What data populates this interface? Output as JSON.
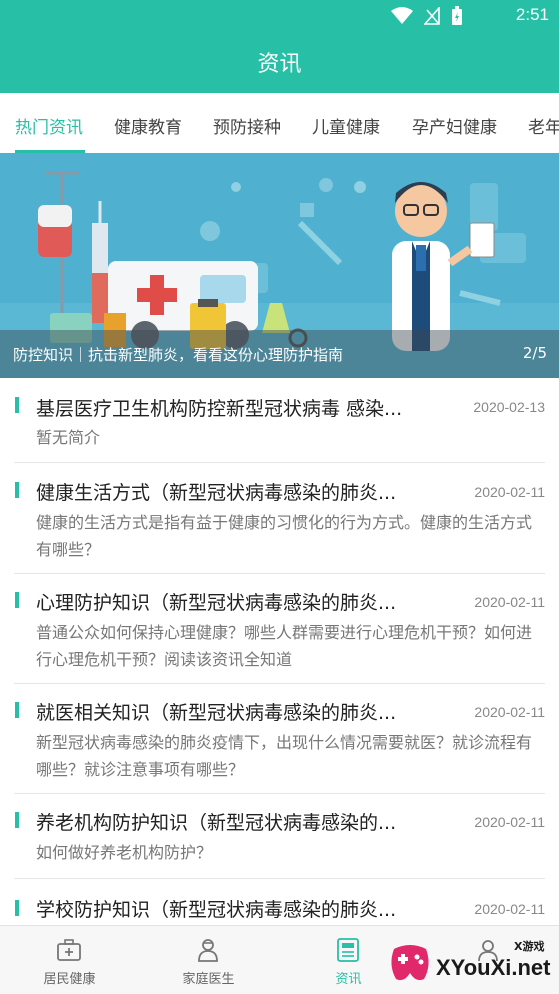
{
  "status": {
    "time": "2:51"
  },
  "appbar": {
    "title": "资讯"
  },
  "tabs": [
    {
      "label": "热门资讯",
      "active": true
    },
    {
      "label": "健康教育"
    },
    {
      "label": "预防接种"
    },
    {
      "label": "儿童健康"
    },
    {
      "label": "孕产妇健康"
    },
    {
      "label": "老年"
    }
  ],
  "banner": {
    "caption": "防控知识｜抗击新型肺炎，看看这份心理防护指南",
    "pager": "2/5"
  },
  "news": [
    {
      "title": "基层医疗卫生机构防控新型冠状病毒 感染...",
      "date": "2020-02-13",
      "desc": "暂无简介"
    },
    {
      "title": "健康生活方式（新型冠状病毒感染的肺炎...",
      "date": "2020-02-11",
      "desc": "健康的生活方式是指有益于健康的习惯化的行为方式。健康的生活方式有哪些？"
    },
    {
      "title": "心理防护知识（新型冠状病毒感染的肺炎...",
      "date": "2020-02-11",
      "desc": "普通公众如何保持心理健康？哪些人群需要进行心理危机干预？如何进行心理危机干预？阅读该资讯全知道"
    },
    {
      "title": "就医相关知识（新型冠状病毒感染的肺炎...",
      "date": "2020-02-11",
      "desc": "新型冠状病毒感染的肺炎疫情下，出现什么情况需要就医？就诊流程有哪些？就诊注意事项有哪些？"
    },
    {
      "title": "养老机构防护知识（新型冠状病毒感染的...",
      "date": "2020-02-11",
      "desc": "如何做好养老机构防护？"
    },
    {
      "title": "学校防护知识（新型冠状病毒感染的肺炎...",
      "date": "2020-02-11",
      "desc": ""
    }
  ],
  "bottomnav": [
    {
      "label": "居民健康",
      "icon": "medical-kit-icon"
    },
    {
      "label": "家庭医生",
      "icon": "doctor-icon"
    },
    {
      "label": "资讯",
      "icon": "news-icon",
      "active": true
    },
    {
      "label": "",
      "icon": "profile-icon"
    }
  ],
  "watermark": {
    "text": "XYouXi.net",
    "small": "X游戏"
  },
  "colors": {
    "primary": "#27c0a6",
    "banner_bg": "#4aaacb"
  }
}
